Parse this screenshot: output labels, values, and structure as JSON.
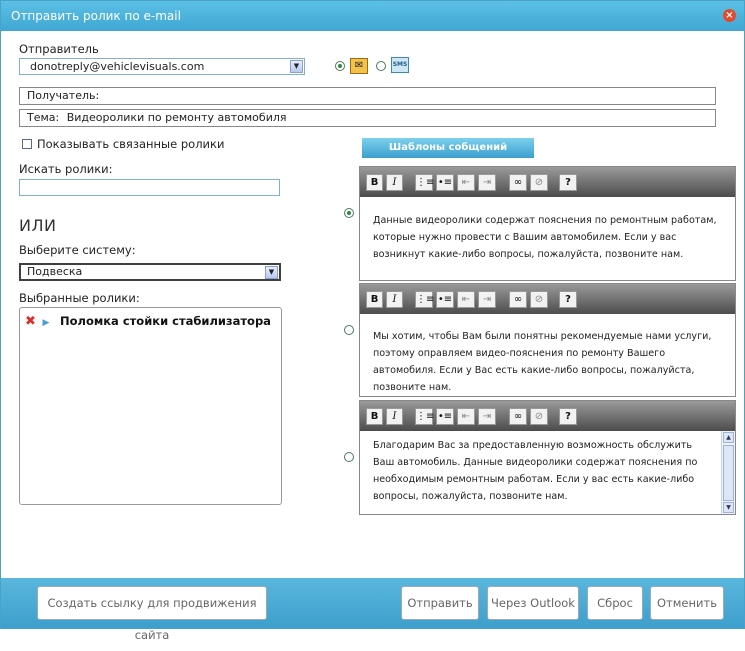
{
  "dialog": {
    "title": "Отправить ролик по e-mail",
    "close_glyph": "×"
  },
  "sender": {
    "label": "Отправитель",
    "value": "donotreply@vehiclevisuals.com"
  },
  "channel": {
    "email_glyph": "✉",
    "sms_text": "SMS",
    "selected": "email"
  },
  "recipient": {
    "label": "Получатель:"
  },
  "subject": {
    "label": "Тема:",
    "value": "Видеоролики по ремонту автомобиля"
  },
  "show_related": {
    "label": "Показывать связанные ролики",
    "checked": false
  },
  "search": {
    "label": "Искать ролики:",
    "value": ""
  },
  "or_label": "ИЛИ",
  "system": {
    "label": "Выберите систему:",
    "value": "Подвеска"
  },
  "selected_videos": {
    "label": "Выбранные ролики:",
    "items": [
      {
        "title": "Поломка стойки стабилизатора"
      }
    ]
  },
  "templates_button": "Шаблоны собщений",
  "toolbar": {
    "bold": "B",
    "italic": "I",
    "ordered_list": "⋮≡",
    "bullet_list": "•≡",
    "outdent": "⇤",
    "indent": "⇥",
    "link": "∞",
    "unlink": "⊘",
    "help": "?"
  },
  "templates": [
    {
      "text": "Данные видеоролики содержат пояснения по ремонтным работам, которые нужно провести с Вашим автомобилем. Если у вас возникнут какие-либо вопросы, пожалуйста, позвоните нам.",
      "selected": true
    },
    {
      "text": "Мы хотим, чтобы Вам были понятны рекомендуемые нами услуги, поэтому оправляем видео-пояснения по ремонту Вашего автомобиля. Если у Вас есть какие-либо вопросы, пожалуйста, позвоните нам.",
      "selected": false
    },
    {
      "text": "Благодарим Вас за предоставленную возможность обслужить Ваш автомобиль. Данные видеоролики содержат пояснения по необходимым ремонтным работам. Если у вас есть какие-либо вопросы, пожалуйста, позвоните нам.",
      "selected": false
    }
  ],
  "footer": {
    "create_link": "Создать ссылку для продвижения сайта",
    "send": "Отправить",
    "via_outlook": "Через Outlook",
    "reset": "Сброс",
    "cancel": "Отменить"
  },
  "colors": {
    "title_bar": "#4fb4de",
    "footer": "#4aaad5",
    "remove_icon": "#d9302a",
    "play_icon": "#4a9fd0"
  }
}
